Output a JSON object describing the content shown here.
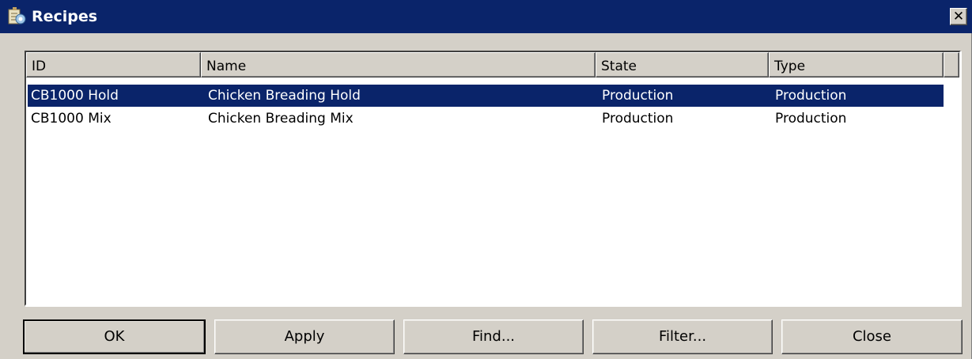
{
  "window": {
    "title": "Recipes"
  },
  "icons": {
    "app": "recipes-app-icon",
    "close": "close-x-icon"
  },
  "table": {
    "columns": [
      "ID",
      "Name",
      "State",
      "Type"
    ],
    "rows": [
      {
        "id": "CB1000 Hold",
        "name": "Chicken Breading Hold",
        "state": "Production",
        "type": "Production",
        "selected": true
      },
      {
        "id": "CB1000 Mix",
        "name": "Chicken Breading Mix",
        "state": "Production",
        "type": "Production",
        "selected": false
      }
    ]
  },
  "buttons": {
    "ok": "OK",
    "apply": "Apply",
    "find": "Find...",
    "filter": "Filter...",
    "close": "Close"
  },
  "colors": {
    "titlebar": "#0a246a",
    "selection": "#0a246a",
    "face": "#d4d0c8"
  }
}
